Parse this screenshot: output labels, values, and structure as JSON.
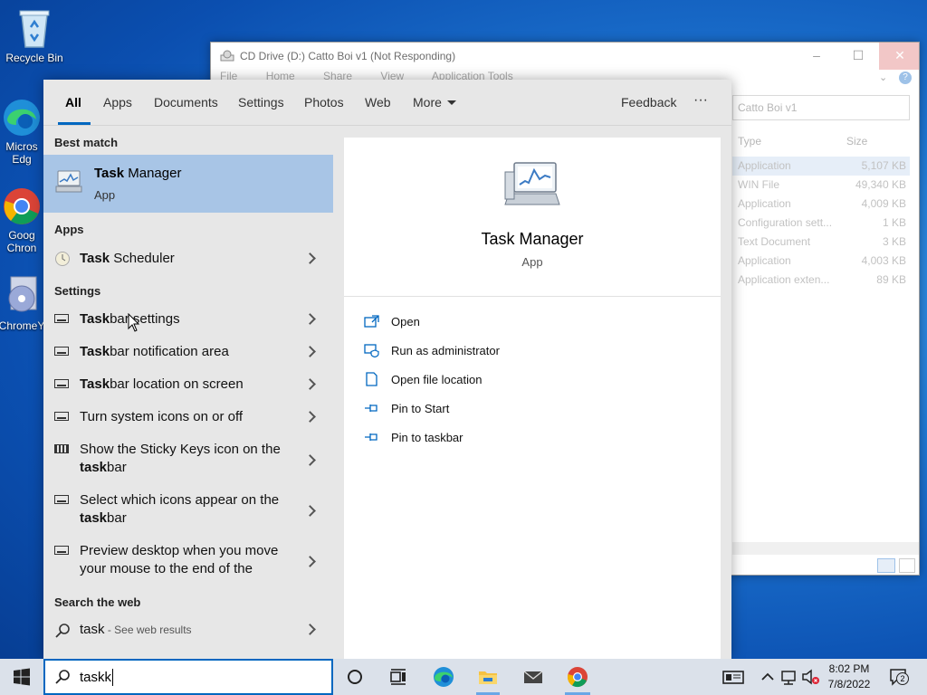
{
  "desktop": {
    "icons": [
      {
        "label": "Recycle Bin",
        "icon": "recycle-bin-icon"
      },
      {
        "label": "Micros Edg",
        "icon": "edge-icon"
      },
      {
        "label": "Goog Chron",
        "icon": "chrome-icon"
      },
      {
        "label": "ChromeY",
        "icon": "chrome-setup-icon"
      }
    ]
  },
  "explorer": {
    "title": "CD Drive (D:) Catto Boi v1 (Not Responding)",
    "ribbon_tabs": [
      "File",
      "Home",
      "Share",
      "View",
      "Application Tools"
    ],
    "search_placeholder": "Catto Boi v1",
    "columns": {
      "type": "Type",
      "size": "Size"
    },
    "rows": [
      {
        "type": "Application",
        "size": "5,107 KB"
      },
      {
        "type": "WIN File",
        "size": "49,340 KB"
      },
      {
        "type": "Application",
        "size": "4,009 KB"
      },
      {
        "type": "Configuration sett...",
        "size": "1 KB"
      },
      {
        "type": "Text Document",
        "size": "3 KB"
      },
      {
        "type": "Application",
        "size": "4,003 KB"
      },
      {
        "type": "Application exten...",
        "size": "89 KB"
      }
    ]
  },
  "search_panel": {
    "tabs": [
      {
        "label": "All",
        "active": true
      },
      {
        "label": "Apps"
      },
      {
        "label": "Documents"
      },
      {
        "label": "Settings"
      },
      {
        "label": "Photos"
      },
      {
        "label": "Web"
      },
      {
        "label": "More"
      }
    ],
    "feedback": "Feedback",
    "options": "···",
    "best_match_heading": "Best match",
    "best_match": {
      "name_bold": "Task",
      "name_rest": " Manager",
      "kind": "App"
    },
    "apps_heading": "Apps",
    "apps": [
      {
        "bold": "Task",
        "rest": " Scheduler"
      }
    ],
    "settings_heading": "Settings",
    "settings": [
      {
        "line1_bold": "Task",
        "line1_rest": "bar settings"
      },
      {
        "line1_bold": "Task",
        "line1_rest": "bar notification area"
      },
      {
        "line1_bold": "Task",
        "line1_rest": "bar location on screen"
      },
      {
        "line1_bold": "",
        "line1_rest": "Turn system icons on or off"
      },
      {
        "line1": "Show the Sticky Keys icon on the",
        "line2_bold": "task",
        "line2_rest": "bar"
      },
      {
        "line1": "Select which icons appear on the",
        "line2_bold": "task",
        "line2_rest": "bar"
      },
      {
        "line1": "Preview desktop when you move",
        "line2": "your mouse to the end of the"
      }
    ],
    "web_heading": "Search the web",
    "web": {
      "query": "task",
      "suffix": " - See web results"
    },
    "preview": {
      "title": "Task Manager",
      "subtitle": "App",
      "actions": [
        {
          "label": "Open",
          "icon": "open-icon"
        },
        {
          "label": "Run as administrator",
          "icon": "shield-icon"
        },
        {
          "label": "Open file location",
          "icon": "file-location-icon"
        },
        {
          "label": "Pin to Start",
          "icon": "pin-icon"
        },
        {
          "label": "Pin to taskbar",
          "icon": "pin-icon"
        }
      ]
    }
  },
  "taskbar": {
    "search_text": "taskk",
    "time": "8:02 PM",
    "date": "7/8/2022",
    "notification_count": "2",
    "colors": {
      "accent": "#0067c0",
      "highlight": "#a8c5e6"
    }
  }
}
